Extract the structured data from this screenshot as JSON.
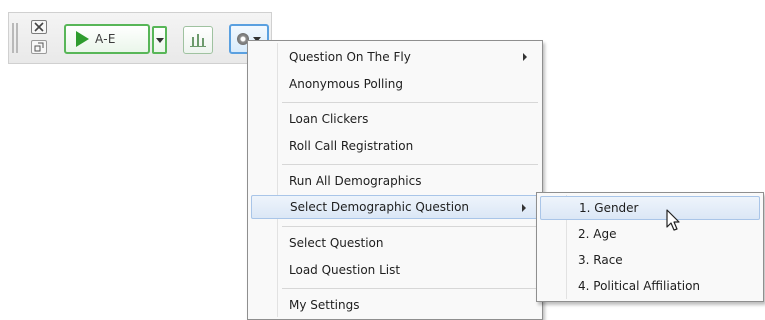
{
  "toolbar": {
    "close_icon": "close-icon",
    "dock_icon": "dock-icon",
    "start_label": "A-E",
    "start_icon": "play-icon",
    "results_icon": "bar-chart-icon",
    "options_icon": "gear-icon",
    "accent_green": "#58b658",
    "accent_blue": "#5aa0e0"
  },
  "menu": {
    "items": [
      {
        "label": "Question On The Fly",
        "has_submenu": true
      },
      {
        "label": "Anonymous Polling"
      },
      {
        "label": "Loan Clickers"
      },
      {
        "label": "Roll Call Registration"
      },
      {
        "label": "Run All Demographics"
      },
      {
        "label": "Select Demographic Question",
        "has_submenu": true,
        "highlighted": true
      },
      {
        "label": "Select Question"
      },
      {
        "label": "Load Question List"
      },
      {
        "label": "My Settings"
      }
    ]
  },
  "submenu": {
    "items": [
      {
        "label": "1. Gender",
        "highlighted": true
      },
      {
        "label": "2. Age"
      },
      {
        "label": "3. Race"
      },
      {
        "label": "4. Political Affiliation"
      }
    ]
  },
  "highlight_color": "#dbe7f6"
}
